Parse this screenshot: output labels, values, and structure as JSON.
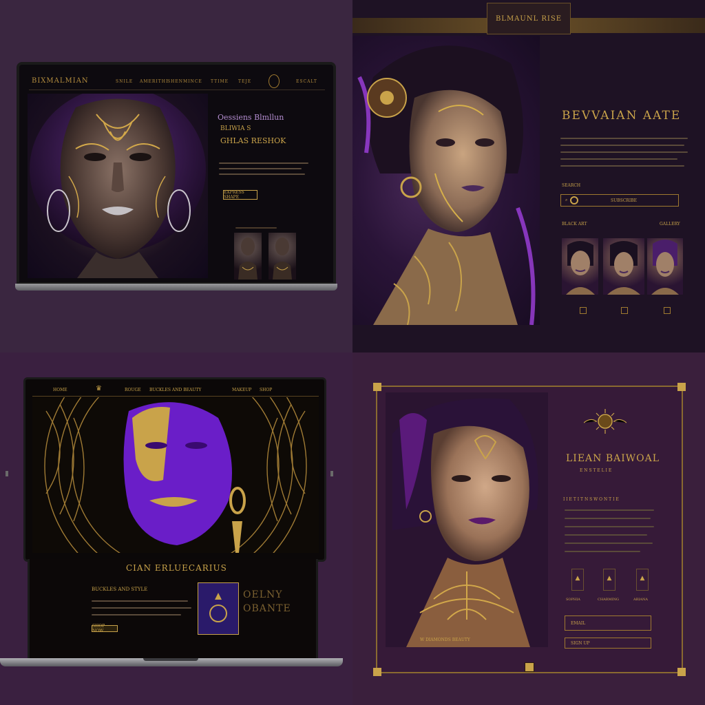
{
  "q1": {
    "brand": "BIXMALMIAN",
    "nav": [
      "SNILE",
      "AMERITHI",
      "SHENMINCE",
      "TTIME",
      "TEJE",
      "ESCALT"
    ],
    "headline1": "Oessiens Blmllun",
    "headline2": "BLIWIA S",
    "headline3": "GHLAS RESHOK",
    "cta": "EXPRESS SHAPE"
  },
  "q2": {
    "banner": "BLMAUNL RISE",
    "title": "BEVVAIAN  AATE",
    "search_label": "SEARCH",
    "search_placeholder": "SUBSCRIBE",
    "left_label": "BLACK ART",
    "right_label": "GALLERY"
  },
  "q3": {
    "nav": [
      "HOME",
      "ROUGE",
      "BUCKLES AND BEAUTY",
      "MAKEUP",
      "SHOP"
    ],
    "section_title": "CIAN ERLUECARIUS",
    "subheading": "BUCKLES AND STYLE",
    "cta": "SHOP NOW",
    "side_text1": "OELNY",
    "side_text2": "OBANTE"
  },
  "q4": {
    "title": "LIEAN BAIWOAL",
    "subtitle": "E N S T E L I E",
    "subheading": "I I E T I T N S W O N T I E",
    "icon_labels": [
      "SOPHIA",
      "CHARMING",
      "ARIANA"
    ],
    "input1": "EMAIL",
    "input2": "SIGN UP",
    "footer": "W DIAMONDS BEAUTY"
  },
  "colors": {
    "gold": "#c9a34a",
    "purple": "#7a2cc8",
    "dark": "#0d0a0f"
  }
}
